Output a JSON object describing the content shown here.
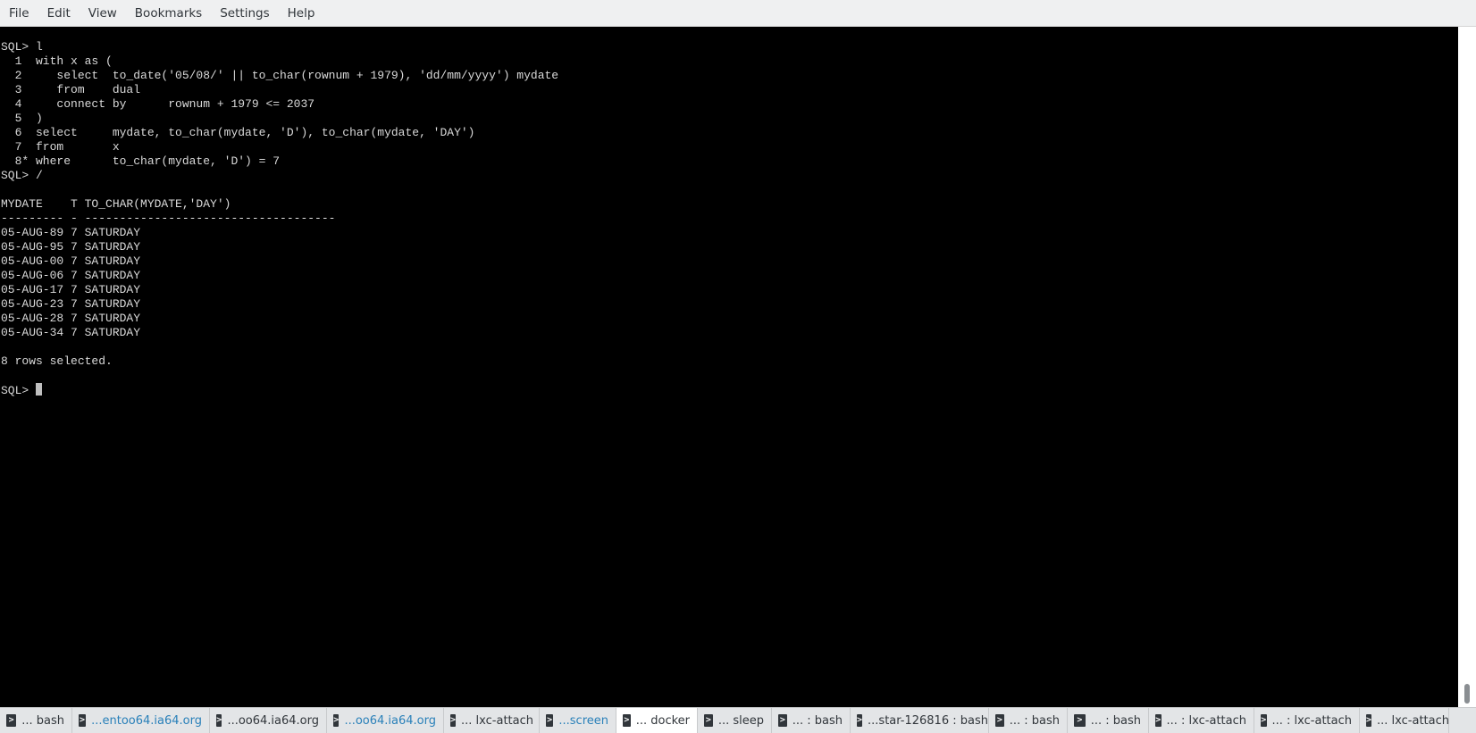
{
  "menubar": {
    "items": [
      "File",
      "Edit",
      "View",
      "Bookmarks",
      "Settings",
      "Help"
    ]
  },
  "terminal": {
    "lines": [
      "SQL> l",
      "  1  with x as (",
      "  2     select  to_date('05/08/' || to_char(rownum + 1979), 'dd/mm/yyyy') mydate",
      "  3     from    dual",
      "  4     connect by      rownum + 1979 <= 2037",
      "  5  )",
      "  6  select     mydate, to_char(mydate, 'D'), to_char(mydate, 'DAY')",
      "  7  from       x",
      "  8* where      to_char(mydate, 'D') = 7",
      "SQL> /",
      "",
      "MYDATE    T TO_CHAR(MYDATE,'DAY')",
      "--------- - ------------------------------------",
      "05-AUG-89 7 SATURDAY",
      "05-AUG-95 7 SATURDAY",
      "05-AUG-00 7 SATURDAY",
      "05-AUG-06 7 SATURDAY",
      "05-AUG-17 7 SATURDAY",
      "05-AUG-23 7 SATURDAY",
      "05-AUG-28 7 SATURDAY",
      "05-AUG-34 7 SATURDAY",
      "",
      "8 rows selected.",
      ""
    ],
    "prompt": "SQL> "
  },
  "tabs": [
    {
      "label": "... bash",
      "style": "normal",
      "width": 81
    },
    {
      "label": "...entoo64.ia64.org",
      "style": "link",
      "width": 154
    },
    {
      "label": "...oo64.ia64.org",
      "style": "normal",
      "width": 131
    },
    {
      "label": "...oo64.ia64.org",
      "style": "link",
      "width": 131
    },
    {
      "label": "... lxc-attach",
      "style": "normal",
      "width": 107
    },
    {
      "label": "...screen",
      "style": "link",
      "width": 86
    },
    {
      "label": "... docker",
      "style": "active",
      "width": 91
    },
    {
      "label": "... sleep",
      "style": "normal",
      "width": 83
    },
    {
      "label": "... : bash",
      "style": "normal",
      "width": 88
    },
    {
      "label": "...star-126816 : bash",
      "style": "normal",
      "width": 155
    },
    {
      "label": "... : bash",
      "style": "normal",
      "width": 88
    },
    {
      "label": "... : bash",
      "style": "normal",
      "width": 91
    },
    {
      "label": "... : lxc-attach",
      "style": "normal",
      "width": 118
    },
    {
      "label": "... : lxc-attach",
      "style": "normal",
      "width": 118
    },
    {
      "label": "... lxc-attach",
      "style": "normal",
      "width": 100
    }
  ]
}
